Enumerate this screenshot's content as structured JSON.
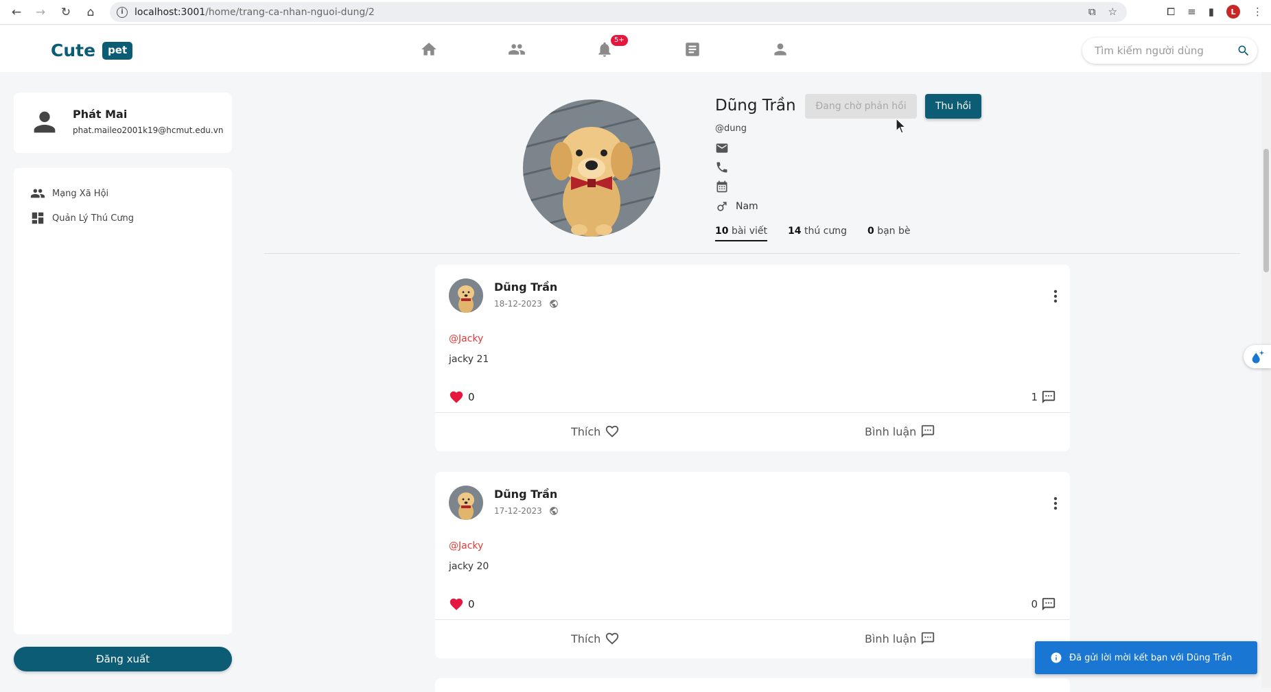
{
  "browser": {
    "url_host": "localhost:3001",
    "url_path": "/home/trang-ca-nhan-nguoi-dung/2",
    "profile_initial": "L"
  },
  "header": {
    "logo_text": "Cute",
    "logo_badge": "pet",
    "notification_count": "5+",
    "search_placeholder": "Tìm kiếm người dùng"
  },
  "sidebar": {
    "user_name": "Phát Mai",
    "user_email": "phat.maileo2001k19@hcmut.edu.vn",
    "items": [
      {
        "label": "Mạng Xã Hội",
        "icon": "people-icon"
      },
      {
        "label": "Quản Lý Thú Cưng",
        "icon": "dashboard-icon"
      }
    ],
    "logout_label": "Đăng xuất"
  },
  "profile": {
    "name": "Dũng Trần",
    "pending_label": "Đang chờ phản hồi",
    "revoke_label": "Thu hồi",
    "handle": "@dung",
    "gender": "Nam",
    "stats": [
      {
        "count": "10",
        "label": "bài viết"
      },
      {
        "count": "14",
        "label": "thú cưng"
      },
      {
        "count": "0",
        "label": "bạn bè"
      }
    ]
  },
  "posts": [
    {
      "author": "Dũng Trần",
      "date": "18-12-2023",
      "tag": "@Jacky",
      "text": "jacky 21",
      "likes": "0",
      "comments": "1",
      "like_label": "Thích",
      "comment_label": "Bình luận"
    },
    {
      "author": "Dũng Trần",
      "date": "17-12-2023",
      "tag": "@Jacky",
      "text": "jacky 20",
      "likes": "0",
      "comments": "0",
      "like_label": "Thích",
      "comment_label": "Bình luận"
    }
  ],
  "toast": {
    "message": "Đã gửi lời mời kết bạn với Dũng Trần"
  },
  "colors": {
    "brand": "#0d5c75",
    "like_red": "#e5173f",
    "toast_blue": "#1976d2",
    "tag_red": "#e53935"
  }
}
